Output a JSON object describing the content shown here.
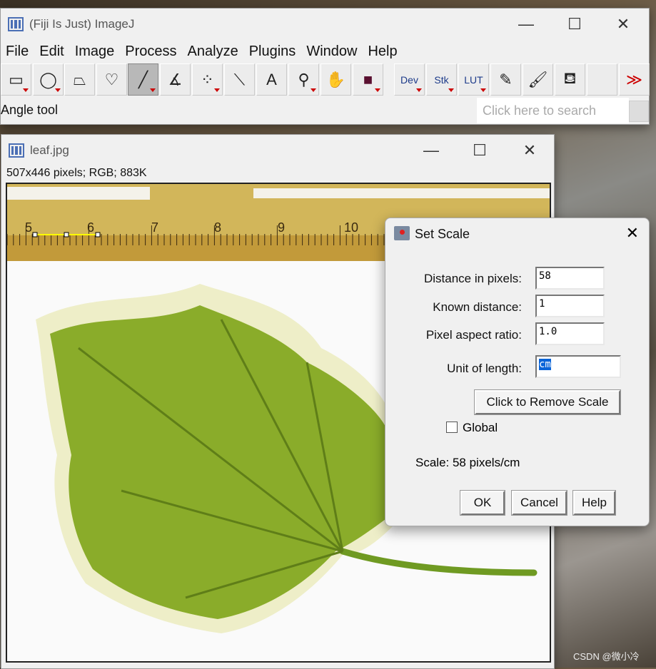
{
  "main_window": {
    "title": "(Fiji Is Just) ImageJ",
    "menu": [
      "File",
      "Edit",
      "Image",
      "Process",
      "Analyze",
      "Plugins",
      "Window",
      "Help"
    ],
    "tools": [
      {
        "name": "rectangle-tool",
        "glyph": "▭",
        "dd": true
      },
      {
        "name": "oval-tool",
        "glyph": "◯",
        "dd": true
      },
      {
        "name": "polygon-tool",
        "glyph": "⏢",
        "dd": false
      },
      {
        "name": "freehand-tool",
        "glyph": "♡",
        "dd": false
      },
      {
        "name": "line-tool",
        "glyph": "╱",
        "dd": true,
        "selected": true
      },
      {
        "name": "angle-tool",
        "glyph": "∡",
        "dd": false
      },
      {
        "name": "point-tool",
        "glyph": "⁘",
        "dd": true
      },
      {
        "name": "wand-tool",
        "glyph": "⟍",
        "dd": false
      },
      {
        "name": "text-tool",
        "glyph": "A",
        "dd": false
      },
      {
        "name": "magnifier-tool",
        "glyph": "⚲",
        "dd": true
      },
      {
        "name": "hand-tool",
        "glyph": "✋",
        "dd": false
      },
      {
        "name": "color-picker-tool",
        "glyph": "■",
        "dd": true
      },
      {
        "name": "dev-menu",
        "glyph": "Dev",
        "dd": true,
        "text": true
      },
      {
        "name": "stk-menu",
        "glyph": "Stk",
        "dd": true,
        "text": true
      },
      {
        "name": "lut-menu",
        "glyph": "LUT",
        "dd": true,
        "text": true
      },
      {
        "name": "pencil-tool",
        "glyph": "✎",
        "dd": false
      },
      {
        "name": "brush-tool",
        "glyph": "🖌",
        "dd": false
      },
      {
        "name": "flood-fill-tool",
        "glyph": "⛾",
        "dd": false
      },
      {
        "name": "empty-tool",
        "glyph": "",
        "dd": false
      },
      {
        "name": "more-tools",
        "glyph": "≫",
        "dd": false
      }
    ],
    "status": "Angle tool",
    "search_placeholder": "Click here to search"
  },
  "image_window": {
    "title": "leaf.jpg",
    "info": "507x446 pixels; RGB; 883K",
    "ruler_numbers": [
      "5",
      "6",
      "7",
      "8",
      "9",
      "10"
    ]
  },
  "dialog": {
    "title": "Set Scale",
    "fields": [
      {
        "label": "Distance in pixels:",
        "value": "58"
      },
      {
        "label": "Known distance:",
        "value": "1"
      },
      {
        "label": "Pixel aspect ratio:",
        "value": "1.0"
      },
      {
        "label": "Unit of length:",
        "value": "cm"
      }
    ],
    "remove_scale": "Click to Remove Scale",
    "global_label": "Global",
    "global_checked": false,
    "scale_text": "Scale: 58 pixels/cm",
    "ok": "OK",
    "cancel": "Cancel",
    "help": "Help"
  },
  "watermark": "CSDN @微小冷",
  "colors": {
    "selection_highlight": "#0a64d8",
    "ruler": "#d2b65a",
    "roi_line": "#ffff00"
  }
}
